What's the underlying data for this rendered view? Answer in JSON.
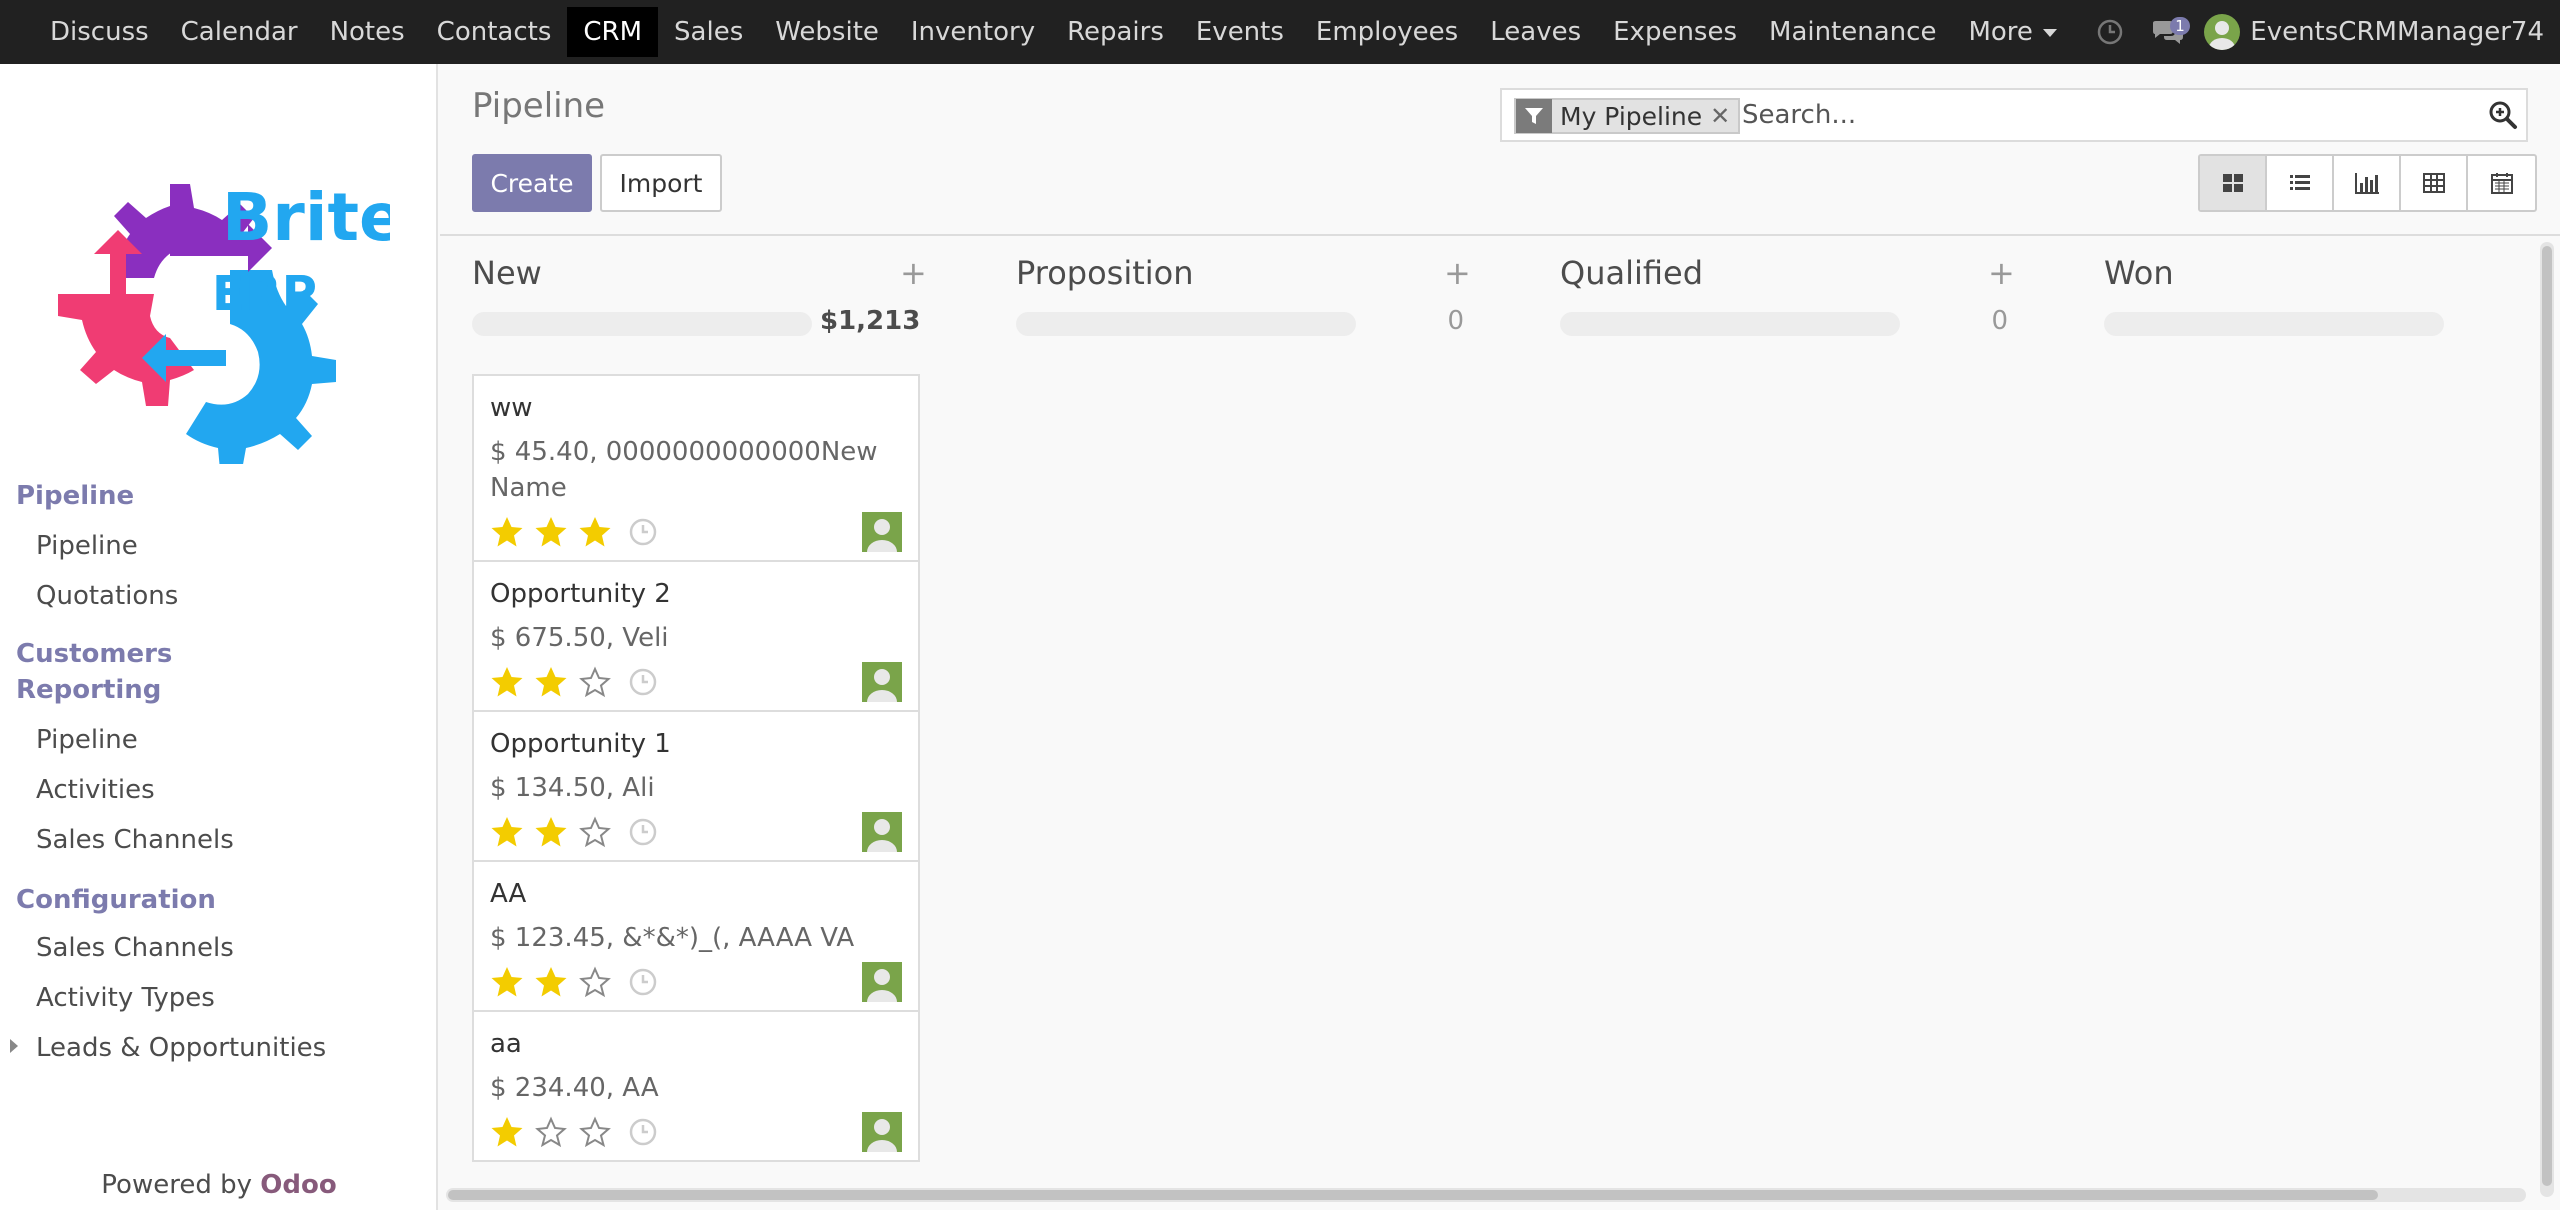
{
  "topbar": {
    "menu": [
      "Discuss",
      "Calendar",
      "Notes",
      "Contacts",
      "CRM",
      "Sales",
      "Website",
      "Inventory",
      "Repairs",
      "Events",
      "Employees",
      "Leaves",
      "Expenses",
      "Maintenance",
      "More"
    ],
    "active_index": 4,
    "message_count": "1",
    "user_name": "EventsCRMManager74"
  },
  "sidebar": {
    "logo_text_1": "Brite",
    "logo_text_2": "ERP",
    "sections": [
      {
        "title": "Pipeline",
        "items": [
          "Pipeline",
          "Quotations"
        ]
      },
      {
        "title": "Customers Reporting",
        "items": [
          "Pipeline",
          "Activities",
          "Sales Channels"
        ]
      },
      {
        "title": "Configuration",
        "items": [
          "Sales Channels",
          "Activity Types",
          "Leads & Opportunities"
        ]
      }
    ],
    "powered_prefix": "Powered by ",
    "powered_brand": "Odoo"
  },
  "control_panel": {
    "title": "Pipeline",
    "create_label": "Create",
    "import_label": "Import",
    "search_facet": "My Pipeline",
    "search_placeholder": "Search..."
  },
  "kanban": {
    "columns": [
      {
        "title": "New",
        "sum": "$1,213"
      },
      {
        "title": "Proposition",
        "sum": "0"
      },
      {
        "title": "Qualified",
        "sum": "0"
      },
      {
        "title": "Won",
        "sum": ""
      }
    ],
    "cards": [
      {
        "name": "ww",
        "sub": "$ 45.40, 0000000000000NewName",
        "stars": 3
      },
      {
        "name": "Opportunity 2",
        "sub": "$ 675.50, Veli",
        "stars": 2
      },
      {
        "name": "Opportunity 1",
        "sub": "$ 134.50, Ali",
        "stars": 2
      },
      {
        "name": "AA",
        "sub": "$ 123.45, &*&*)_(, AAAA VA",
        "stars": 2
      },
      {
        "name": "aa",
        "sub": "$ 234.40, AA",
        "stars": 1
      }
    ]
  },
  "colors": {
    "accent": "#7c7bad",
    "star_on": "#f3cc00",
    "avatar": "#7aa44a"
  }
}
